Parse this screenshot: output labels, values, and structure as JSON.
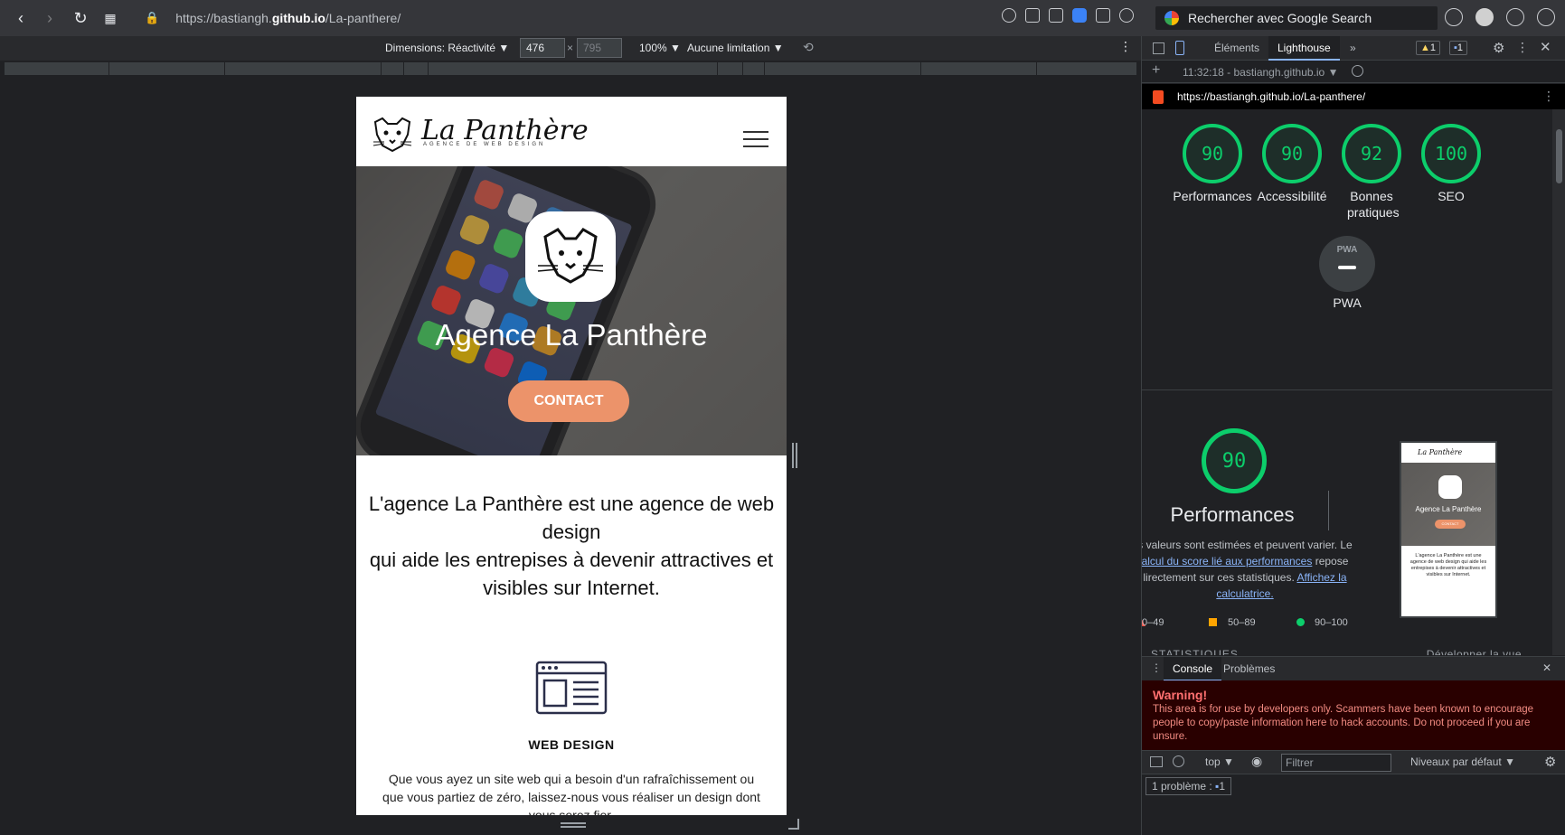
{
  "browser": {
    "url_prefix": "https://bastiangh.",
    "url_bold": "github.io",
    "url_suffix": "/La-panthere/",
    "search_placeholder": "Rechercher avec Google Search"
  },
  "device_toolbar": {
    "dimensions_label": "Dimensions: Réactivité ▼",
    "width": "476",
    "height": "795",
    "times": "×",
    "zoom": "100% ▼",
    "throttle": "Aucune limitation ▼"
  },
  "site": {
    "logo_text": "La Panthère",
    "logo_subtitle": "AGENCE DE WEB DESIGN",
    "hero_title": "Agence La Panthère",
    "contact_label": "CONTACT",
    "intro_lines": [
      "L'agence La Panthère est une agence de web design",
      "qui aide les entrepises à devenir attractives et visibles sur Internet."
    ],
    "service_title": "WEB DESIGN",
    "service_text": "Que vous ayez un site web qui a besoin d'un rafraîchissement ou que vous partiez de zéro, laissez-nous vous réaliser un design dont vous serez fier."
  },
  "devtools": {
    "tabs": [
      "Éléments",
      "Lighthouse",
      "»"
    ],
    "active_tab": "Lighthouse",
    "warnings_count": "1",
    "messages_count": "1",
    "report_time": "11:32:18 - bastiangh.github.io ▼",
    "report_url": "https://bastiangh.github.io/La-panthere/",
    "scores": [
      {
        "label": "Performances",
        "value": "90"
      },
      {
        "label": "Accessibilité",
        "value": "90"
      },
      {
        "label": "Bonnes pratiques",
        "value": "92"
      },
      {
        "label": "SEO",
        "value": "100"
      }
    ],
    "pwa_label": "PWA",
    "pwa_icon_text": "PWA",
    "perf_score": "90",
    "perf_title": "Performances",
    "perf_desc_1": "s valeurs sont estimées et peuvent varier. Le",
    "perf_link_1": "alcul du score lié aux performances",
    "perf_desc_2": " repose",
    "perf_desc_3": "lirectement sur ces statistiques. ",
    "perf_link_2": "Affichez la calculatrice.",
    "legend": [
      "0–49",
      "50–89",
      "90–100"
    ],
    "thumb_title": "La Panthère",
    "thumb_hero": "Agence La Panthère",
    "thumb_btn": "CONTACT",
    "thumb_text": "L'agence La Panthère est une agence de web design qui aide les entrepises à devenir attractives et visibles sur Internet.",
    "stats_label": "STATISTIQUES",
    "expand_label": "Développer la vue",
    "console_tab": "Console",
    "issues_tab": "Problèmes",
    "warning_title": "Warning!",
    "warning_text": "This area is for use by developers only. Scammers have been known to encourage people to copy/paste information here to hack accounts. Do not proceed if you are unsure.",
    "context": "top ▼",
    "filter_placeholder": "Filtrer",
    "levels": "Niveaux par défaut ▼",
    "issues_label": "1 problème :",
    "issues_count": "1"
  },
  "colors": {
    "accent_green": "#0cce6b",
    "contact_orange": "#ec936a",
    "legend_orange": "#ffa400",
    "link_blue": "#8ab4f8"
  }
}
